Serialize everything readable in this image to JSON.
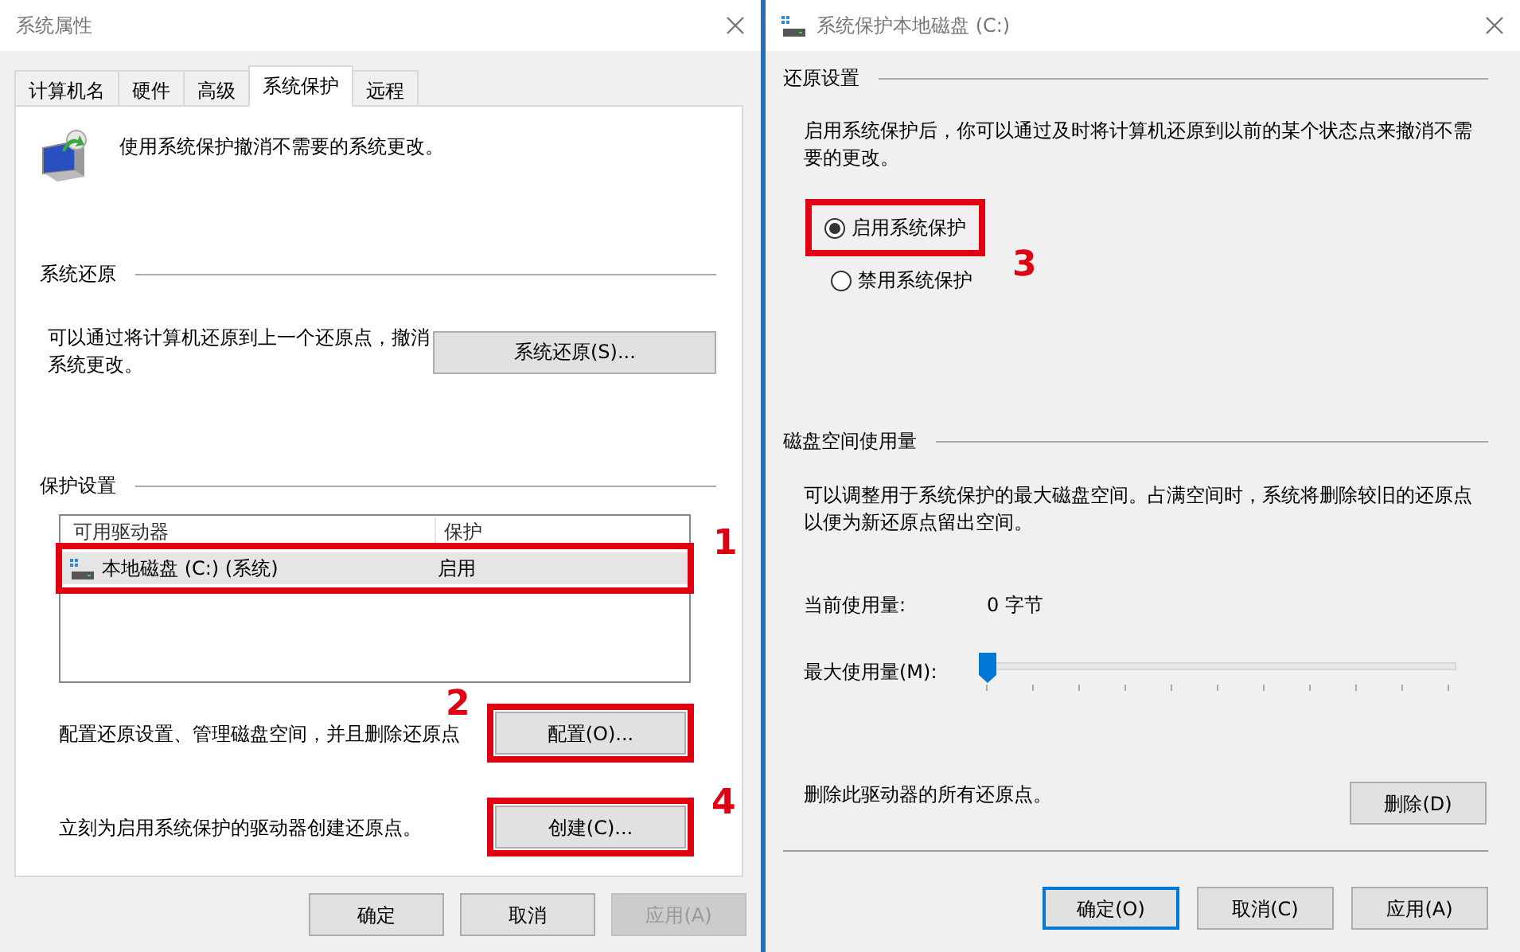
{
  "left_window": {
    "title": "系统属性",
    "tabs": [
      {
        "label": "计算机名",
        "selected": false
      },
      {
        "label": "硬件",
        "selected": false
      },
      {
        "label": "高级",
        "selected": false
      },
      {
        "label": "系统保护",
        "selected": true
      },
      {
        "label": "远程",
        "selected": false
      }
    ],
    "intro_text": "使用系统保护撤消不需要的系统更改。",
    "system_restore": {
      "heading": "系统还原",
      "text": "可以通过将计算机还原到上一个还原点，撤消系统更改。",
      "button": "系统还原(S)..."
    },
    "protection_settings": {
      "heading": "保护设置",
      "columns": [
        "可用驱动器",
        "保护"
      ],
      "rows": [
        {
          "drive": "本地磁盘 (C:) (系统)",
          "protection": "启用",
          "selected": true,
          "step": "1"
        }
      ],
      "configure": {
        "text": "配置还原设置、管理磁盘空间，并且删除还原点",
        "button": "配置(O)...",
        "step": "2"
      },
      "create": {
        "text": "立刻为启用系统保护的驱动器创建还原点。",
        "button": "创建(C)...",
        "step": "4"
      }
    },
    "buttons": [
      {
        "label": "确定",
        "disabled": false
      },
      {
        "label": "取消",
        "disabled": false
      },
      {
        "label": "应用(A)",
        "disabled": true
      }
    ]
  },
  "right_window": {
    "title": "系统保护本地磁盘 (C:)",
    "restore_settings": {
      "heading": "还原设置",
      "text": "启用系统保护后，你可以通过及时将计算机还原到以前的某个状态点来撤消不需要的更改。",
      "options": [
        {
          "label": "启用系统保护",
          "selected": true,
          "step": "3"
        },
        {
          "label": "禁用系统保护",
          "selected": false
        }
      ]
    },
    "disk_usage": {
      "heading": "磁盘空间使用量",
      "text": "可以调整用于系统保护的最大磁盘空间。占满空间时，系统将删除较旧的还原点以便为新还原点留出空间。",
      "current_label": "当前使用量:",
      "current_value": "0 字节",
      "max_label": "最大使用量(M):",
      "slider": {
        "level": 0
      }
    },
    "delete": {
      "text": "删除此驱动器的所有还原点。",
      "button": "删除(D)"
    },
    "buttons": [
      {
        "label": "确定(O)",
        "default": true
      },
      {
        "label": "取消(C)",
        "default": false
      },
      {
        "label": "应用(A)",
        "default": false
      }
    ]
  }
}
